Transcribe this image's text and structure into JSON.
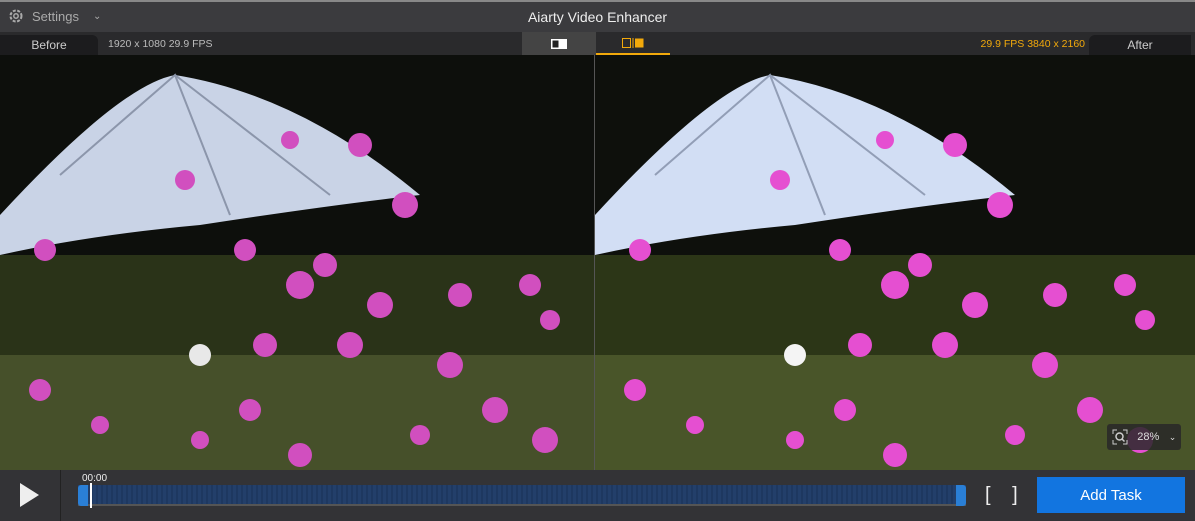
{
  "titlebar": {
    "settings_label": "Settings",
    "title": "Aiarty Video Enhancer"
  },
  "tabs": {
    "before": "Before",
    "after": "After",
    "before_info": "1920 x 1080  29.9 FPS",
    "after_info": "29.9 FPS  3840 x 2160"
  },
  "colors": {
    "accent": "#f2a90b",
    "primary": "#1275e0"
  },
  "preview": {
    "zoom": "28%"
  },
  "timeline": {
    "time": "00:00",
    "progress": 0
  },
  "actions": {
    "add_task": "Add Task"
  }
}
